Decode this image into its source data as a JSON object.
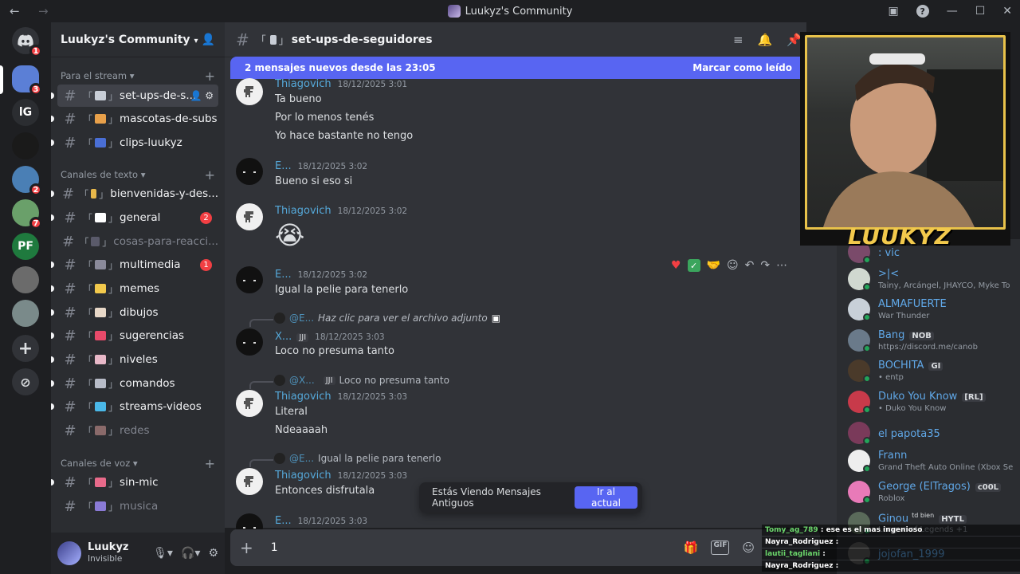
{
  "window": {
    "title": "Luukyz's Community"
  },
  "rail": {
    "home_badge": "1",
    "servers": [
      {
        "badge": "3",
        "color": "#5b7fd6"
      },
      {
        "label": "lG",
        "color": "#2b2d31"
      },
      {
        "color": "#1a1a1a"
      },
      {
        "badge": "2",
        "color": "#4a7fb5"
      },
      {
        "badge": "7",
        "color": "#6aa06a"
      },
      {
        "label": "PF",
        "color": "#1f7a3e"
      },
      {
        "color": "#6b6b6b"
      },
      {
        "color": "#7a8a8a"
      }
    ]
  },
  "server": {
    "name": "Luukyz's Community"
  },
  "categories": [
    "Para el stream",
    "Canales de texto",
    "Canales de voz"
  ],
  "channels": [
    {
      "name": "set-ups-de-s...",
      "emoji_color": "#c8cdd6",
      "active": true,
      "unread": true
    },
    {
      "name": "mascotas-de-subs",
      "emoji_color": "#e8a04a",
      "unread": true
    },
    {
      "name": "clips-luukyz",
      "emoji_color": "#4a6fd6",
      "unread": true
    },
    {
      "name": "bienvenidas-y-des...",
      "emoji_color": "#e8b84a",
      "unread": true
    },
    {
      "name": "general",
      "emoji_color": "#ffffff",
      "unread": true,
      "badge": "2"
    },
    {
      "name": "cosas-para-reacci...",
      "emoji_color": "#5a5a6a",
      "muted": true
    },
    {
      "name": "multimedia",
      "emoji_color": "#8a8a9a",
      "unread": true,
      "badge": "1"
    },
    {
      "name": "memes",
      "emoji_color": "#f2c94c",
      "unread": true
    },
    {
      "name": "dibujos",
      "emoji_color": "#e8d8c8",
      "unread": true
    },
    {
      "name": "sugerencias",
      "emoji_color": "#e84a6a",
      "unread": true
    },
    {
      "name": "niveles",
      "emoji_color": "#e8b8c8",
      "unread": true
    },
    {
      "name": "comandos",
      "emoji_color": "#b8bcc8",
      "unread": true
    },
    {
      "name": "streams-videos",
      "emoji_color": "#4ab8e8",
      "unread": true
    },
    {
      "name": "redes",
      "emoji_color": "#8a6a6a",
      "muted": true
    },
    {
      "name": "sin-mic",
      "emoji_color": "#e86a8a",
      "unread": true
    },
    {
      "name": "musica",
      "emoji_color": "#8a7ad6",
      "muted": true
    }
  ],
  "user": {
    "name": "Luukyz",
    "status": "Invisible"
  },
  "chat_header": {
    "channel": "set-ups-de-seguidores"
  },
  "new_bar": {
    "text": "2 mensajes nuevos desde las 23:05",
    "action": "Marcar como leído"
  },
  "messages": [
    {
      "author": "Thiagovich",
      "time": "18/12/2025 3:01",
      "lines": [
        "Ta bueno",
        "Por lo menos tenés",
        "Yo hace bastante no tengo"
      ]
    },
    {
      "author": "E...",
      "time": "18/12/2025 3:02",
      "lines": [
        "Bueno si eso si"
      ]
    },
    {
      "author": "Thiagovich",
      "time": "18/12/2025 3:02",
      "emoji": "😭"
    },
    {
      "author": "E...",
      "time": "18/12/2025 3:02",
      "lines": [
        "Igual la pelie para tenerlo"
      ]
    },
    {
      "reply_to": "@E...",
      "reply_text": "Haz clic para ver el archivo adjunto",
      "author": "X...",
      "tag": "JJI",
      "time": "18/12/2025 3:03",
      "lines": [
        "Loco no presuma tanto"
      ]
    },
    {
      "reply_to": "@X...",
      "reply_tag": "JJI",
      "reply_text": "Loco no presuma tanto",
      "author": "Thiagovich",
      "time": "18/12/2025 3:03",
      "lines": [
        "Literal",
        "Ndeaaaah"
      ]
    },
    {
      "reply_to": "@E...",
      "reply_text": "Igual la pelie para tenerlo",
      "author": "Thiagovich",
      "time": "18/12/2025 3:03",
      "lines": [
        "Entonces disfrutala"
      ]
    },
    {
      "author": "E...",
      "time": "18/12/2025 3:03"
    }
  ],
  "toast": {
    "text": "Estás Viendo Mensajes Antiguos",
    "button": "Ir al actual"
  },
  "composer": {
    "value": "1"
  },
  "members": [
    {
      "name": ": vic",
      "activity": ""
    },
    {
      "name": ">|<",
      "activity": "Tainy, Arcángel, JHAYCO, Myke To"
    },
    {
      "name": "ALMAFUERTE",
      "activity": "War Thunder"
    },
    {
      "name": "Bang",
      "tag": "NOB",
      "activity": "https://discord.me/canob"
    },
    {
      "name": "BOCHITA",
      "tag": "GI",
      "activity": "• entp"
    },
    {
      "name": "Duko You Know",
      "tag": "[RL]",
      "activity": "• Duko You Know"
    },
    {
      "name": "el papota35",
      "activity": ""
    },
    {
      "name": "Frann",
      "activity": "Grand Theft Auto Online (Xbox Se"
    },
    {
      "name": "George (ElTragos)",
      "tag": "c00L",
      "activity": "Roblox"
    },
    {
      "name": "Ginou",
      "tag_prefix": "td bien",
      "tag": "HYTL",
      "activity": "League of Legends +1"
    },
    {
      "name": "jojofan_1999",
      "activity": ""
    }
  ],
  "stream_chat": [
    {
      "user": "Tomy_ag_789",
      "text": "ese es el mas ingenioso",
      "color": "#6bd66b"
    },
    {
      "user": "Nayra_Rodriguez",
      "text": "",
      "color": "#ffffff"
    },
    {
      "user": "lautii_tagliani",
      "text": "",
      "color": "#6bd66b"
    },
    {
      "user": "Nayra_Rodriguez",
      "text": "",
      "color": "#ffffff"
    }
  ],
  "webcam": {
    "logo": "LUUKYZ"
  }
}
